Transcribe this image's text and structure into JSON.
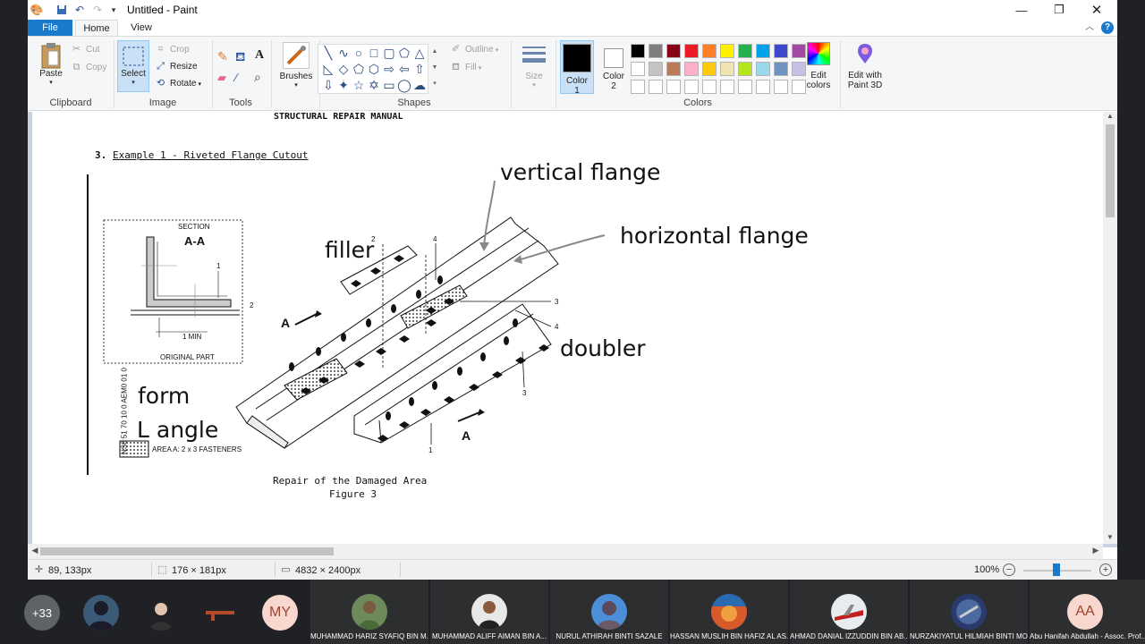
{
  "window": {
    "title": "Untitled - Paint",
    "controls": [
      "minimize-icon",
      "restore-icon",
      "close-icon"
    ]
  },
  "tabs": {
    "file": "File",
    "home": "Home",
    "view": "View"
  },
  "ribbon": {
    "clipboard": {
      "label": "Clipboard",
      "paste": "Paste",
      "cut": "Cut",
      "copy": "Copy"
    },
    "image": {
      "label": "Image",
      "select": "Select",
      "crop": "Crop",
      "resize": "Resize",
      "rotate": "Rotate"
    },
    "tools": {
      "label": "Tools"
    },
    "brushes": {
      "label": "Brushes"
    },
    "shapes": {
      "label": "Shapes",
      "outline": "Outline",
      "fill": "Fill"
    },
    "size": {
      "label": "Size"
    },
    "colors": {
      "label": "Colors",
      "color1": "Color\n1",
      "color1_a": "Color",
      "color1_b": "1",
      "color2_a": "Color",
      "color2_b": "2",
      "edit_colors_a": "Edit",
      "edit_colors_b": "colors",
      "edit_paint3d_a": "Edit with",
      "edit_paint3d_b": "Paint 3D",
      "palette_row1": [
        "#000000",
        "#7f7f7f",
        "#880015",
        "#ed1c24",
        "#ff7f27",
        "#fff200",
        "#22b14c",
        "#00a2e8",
        "#3f48cc",
        "#a349a4"
      ],
      "palette_row2": [
        "#ffffff",
        "#c3c3c3",
        "#b97a57",
        "#ffaec9",
        "#ffc90e",
        "#efe4b0",
        "#b5e61d",
        "#99d9ea",
        "#7092be",
        "#c8bfe7"
      ],
      "color1_value": "#000000",
      "color2_value": "#ffffff"
    }
  },
  "canvas": {
    "header": "STRUCTURAL REPAIR MANUAL",
    "example_num": "3.",
    "example_title": "Example 1 - Riveted Flange Cutout",
    "section_label": "SECTION",
    "section_aa": "A-A",
    "min_label": "1 MIN",
    "original_part": "ORIGINAL PART",
    "area_a": "AREA A: 2 x 3 FASTENERS",
    "side_code": "NS6 51 70 10 0 AEM0 01 0",
    "caption_1": "Repair of the Damaged Area",
    "caption_2": "Figure 3",
    "annot_vertical": "vertical flange",
    "annot_horizontal": "horizontal flange",
    "annot_filler": "filler",
    "annot_doubler": "doubler",
    "annot_form": "form",
    "annot_langle": "L angle",
    "callout_a_left": "A",
    "callout_a_right": "A",
    "n1": "1",
    "n2": "2",
    "n3": "3",
    "n4": "4"
  },
  "status": {
    "cursor": "89, 133px",
    "selection": "176 × 181px",
    "image_size": "4832 × 2400px",
    "zoom": "100%"
  },
  "meeting": {
    "overflow_count": "+33",
    "initials_1": "MY",
    "initials_2": "AA",
    "participants": [
      "MUHAMMAD HARIZ SYAFIQ BIN M...",
      "MUHAMMAD ALIFF AIMAN BIN A...",
      "NURUL ATHIRAH BINTI SAZALE",
      "HASSAN MUSLIH BIN HAFIZ AL AS...",
      "AHMAD DANIAL IZZUDDIN BIN AB...",
      "NURZAKIYATUL HILMIAH BINTI MO...",
      "Abu Hanifah Abdullah - Assoc. Prof..."
    ]
  }
}
